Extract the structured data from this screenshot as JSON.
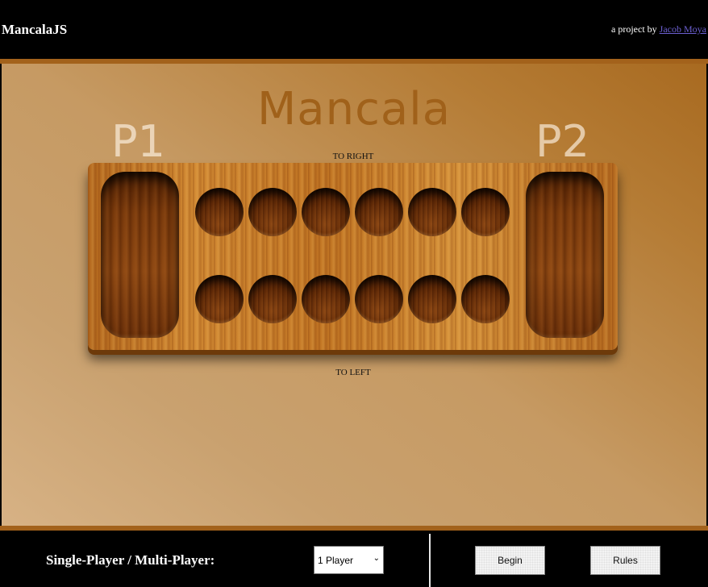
{
  "header": {
    "app_title": "MancalaJS",
    "credit_prefix": "a project by ",
    "credit_link": "Jacob Moya"
  },
  "game": {
    "title": "Mancala",
    "player1_label": "P1",
    "player2_label": "P2",
    "top_direction": "TO RIGHT",
    "bottom_direction": "TO LEFT",
    "top_pits_count": 6,
    "bottom_pits_count": 6
  },
  "controls": {
    "mode_label": "Single-Player / Multi-Player:",
    "mode_select_value": "1 Player",
    "begin_label": "Begin",
    "rules_label": "Rules"
  },
  "colors": {
    "accent_strip": "#a3621b",
    "title_color": "#a0611a",
    "link_color": "#6b5fd0"
  }
}
